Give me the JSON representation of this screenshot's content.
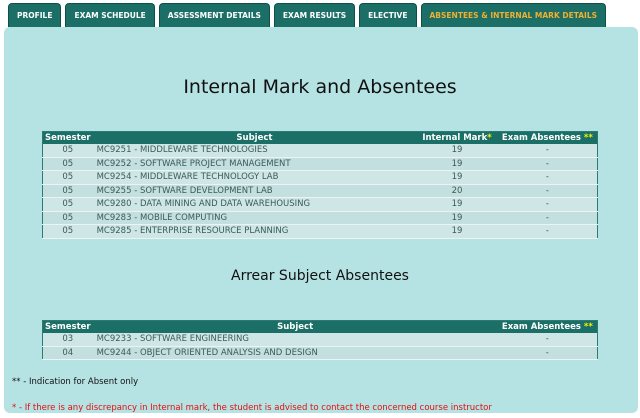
{
  "tabs": [
    {
      "label": "PROFILE",
      "active": false
    },
    {
      "label": "EXAM SCHEDULE",
      "active": false
    },
    {
      "label": "ASSESSMENT DETAILS",
      "active": false
    },
    {
      "label": "EXAM RESULTS",
      "active": false
    },
    {
      "label": "ELECTIVE",
      "active": false
    },
    {
      "label": "ABSENTEES & INTERNAL MARK DETAILS",
      "active": true
    }
  ],
  "main_heading": "Internal Mark and Absentees",
  "internal_table": {
    "headers": {
      "semester": "Semester",
      "subject": "Subject",
      "internal_mark": "Internal Mark",
      "internal_mark_mark": "*",
      "exam_absentees": "Exam Absentees ",
      "exam_absentees_mark": "**"
    },
    "rows": [
      {
        "semester": "05",
        "subject": "MC9251 - MIDDLEWARE TECHNOLOGIES",
        "mark": "19",
        "absentees": "-"
      },
      {
        "semester": "05",
        "subject": "MC9252 - SOFTWARE PROJECT MANAGEMENT",
        "mark": "19",
        "absentees": "-"
      },
      {
        "semester": "05",
        "subject": "MC9254 - MIDDLEWARE TECHNOLOGY LAB",
        "mark": "19",
        "absentees": "-"
      },
      {
        "semester": "05",
        "subject": "MC9255 - SOFTWARE DEVELOPMENT LAB",
        "mark": "20",
        "absentees": "-"
      },
      {
        "semester": "05",
        "subject": "MC9280 - DATA MINING AND DATA WAREHOUSING",
        "mark": "19",
        "absentees": "-"
      },
      {
        "semester": "05",
        "subject": "MC9283 - MOBILE COMPUTING",
        "mark": "19",
        "absentees": "-"
      },
      {
        "semester": "05",
        "subject": "MC9285 - ENTERPRISE RESOURCE PLANNING",
        "mark": "19",
        "absentees": "-"
      }
    ]
  },
  "arrear_heading": "Arrear Subject Absentees",
  "arrear_table": {
    "headers": {
      "semester": "Semester",
      "subject": "Subject",
      "exam_absentees": "Exam Absentees ",
      "exam_absentees_mark": "**"
    },
    "rows": [
      {
        "semester": "03",
        "subject": "MC9233 - SOFTWARE ENGINEERING",
        "absentees": "-"
      },
      {
        "semester": "04",
        "subject": "MC9244 - OBJECT ORIENTED ANALYSIS AND DESIGN",
        "absentees": "-"
      }
    ]
  },
  "notes": {
    "absent": "** - Indication for Absent only",
    "discrepancy": "* - If there is any discrepancy in Internal mark, the student is advised to contact the concerned course instructor"
  },
  "colors": {
    "tab_bg": "#1b6f67",
    "active_tab_text": "#f0b030",
    "panel_bg": "#b5e2e2",
    "header_bg": "#1b6f67",
    "row_bg": "#cfe6e6",
    "star": "#f5f500",
    "note_red": "#e01010"
  }
}
